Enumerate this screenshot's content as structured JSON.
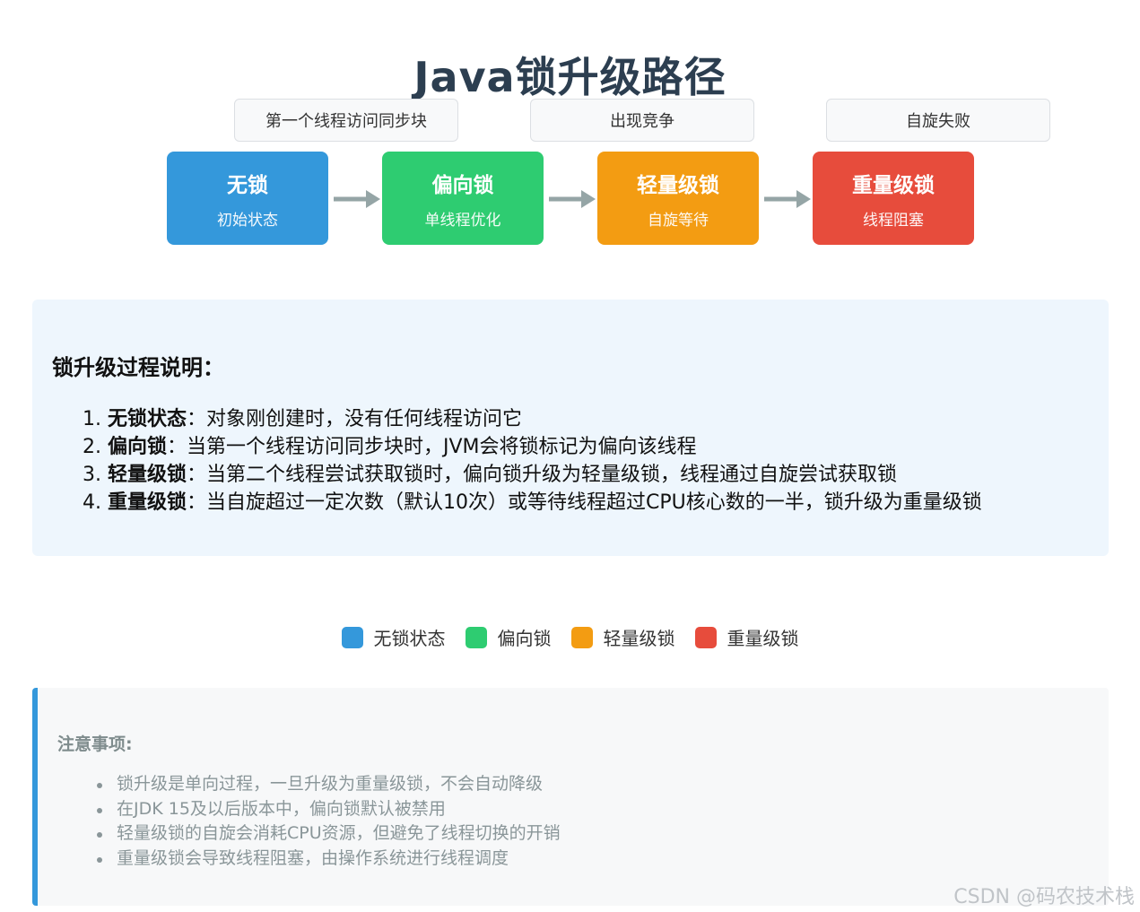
{
  "title": "Java锁升级路径",
  "triggers": [
    "第一个线程访问同步块",
    "出现竞争",
    "自旋失败"
  ],
  "states": [
    {
      "name": "无锁",
      "desc": "初始状态",
      "color": "#3498db"
    },
    {
      "name": "偏向锁",
      "desc": "单线程优化",
      "color": "#2ecc71"
    },
    {
      "name": "轻量级锁",
      "desc": "自旋等待",
      "color": "#f39c12"
    },
    {
      "name": "重量级锁",
      "desc": "线程阻塞",
      "color": "#e74c3c"
    }
  ],
  "arrow_color": "#95a5a6",
  "explanation": {
    "heading": "锁升级过程说明：",
    "items": [
      {
        "num": "1.",
        "term": "无锁状态",
        "text": "：对象刚创建时，没有任何线程访问它"
      },
      {
        "num": "2.",
        "term": "偏向锁",
        "text": "：当第一个线程访问同步块时，JVM会将锁标记为偏向该线程"
      },
      {
        "num": "3.",
        "term": "轻量级锁",
        "text": "：当第二个线程尝试获取锁时，偏向锁升级为轻量级锁，线程通过自旋尝试获取锁"
      },
      {
        "num": "4.",
        "term": "重量级锁",
        "text": "：当自旋超过一定次数（默认10次）或等待线程超过CPU核心数的一半，锁升级为重量级锁"
      }
    ]
  },
  "legend": [
    {
      "label": "无锁状态",
      "color": "#3498db"
    },
    {
      "label": "偏向锁",
      "color": "#2ecc71"
    },
    {
      "label": "轻量级锁",
      "color": "#f39c12"
    },
    {
      "label": "重量级锁",
      "color": "#e74c3c"
    }
  ],
  "notes": {
    "heading": "注意事项:",
    "items": [
      "锁升级是单向过程，一旦升级为重量级锁，不会自动降级",
      "在JDK 15及以后版本中，偏向锁默认被禁用",
      "轻量级锁的自旋会消耗CPU资源，但避免了线程切换的开销",
      "重量级锁会导致线程阻塞，由操作系统进行线程调度"
    ]
  },
  "watermark": "CSDN @码农技术栈"
}
